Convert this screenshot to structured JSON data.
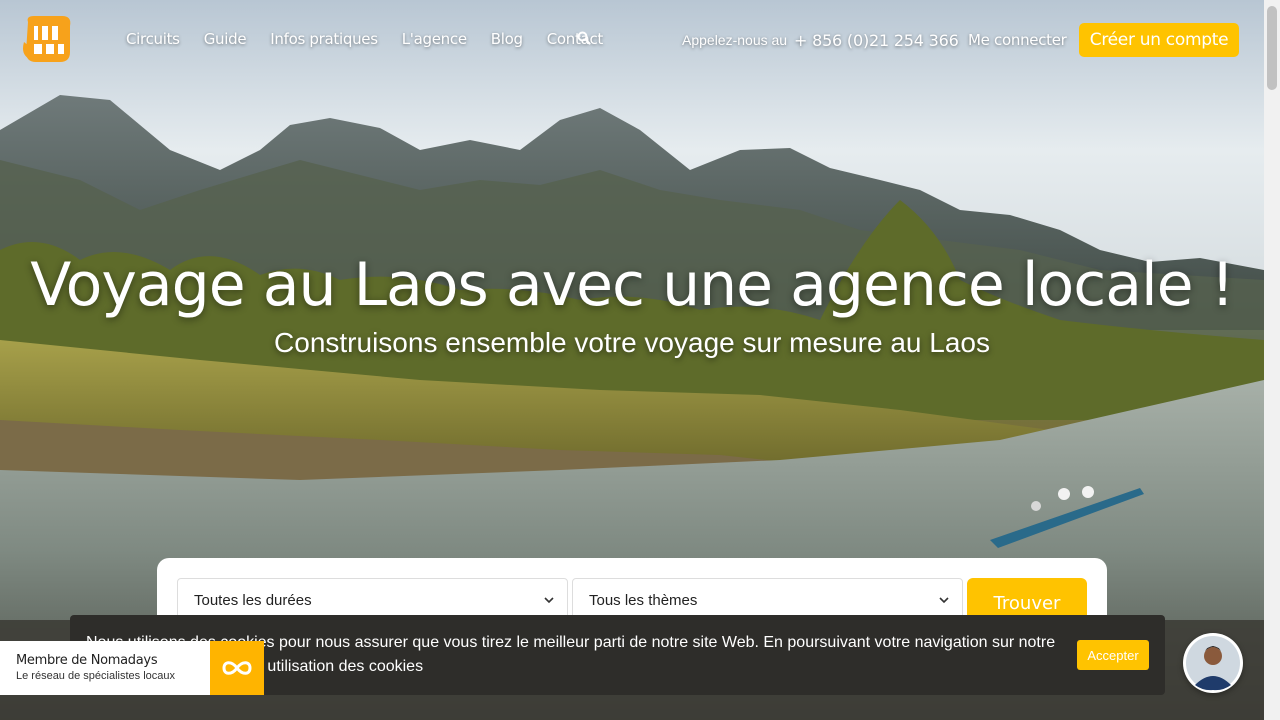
{
  "nav": {
    "links": [
      "Circuits",
      "Guide",
      "Infos pratiques",
      "L'agence",
      "Blog",
      "Contact"
    ],
    "call_label": "Appelez-nous au",
    "phone": "+ 856 (0)21 254 366",
    "login": "Me connecter",
    "create_account": "Créer un compte"
  },
  "hero": {
    "title": "Voyage au Laos avec une agence locale !",
    "subtitle": "Construisons ensemble votre voyage sur mesure au Laos"
  },
  "search": {
    "duration_selected": "Toutes les durées",
    "theme_selected": "Tous les thèmes",
    "find_label": "Trouver"
  },
  "cookie": {
    "text": "Nous utilisons des cookies pour nous assurer que vous tirez le meilleur parti de notre site Web. En poursuivant votre navigation sur notre site, vous acceptez notre utilisation des cookies",
    "accept_label": "Accepter"
  },
  "nomadays": {
    "title": "Membre de Nomadays",
    "subtitle": "Le réseau de spécialistes locaux"
  },
  "colors": {
    "accent": "#ffc300",
    "cookie_bg": "#2e2d2a"
  },
  "icons": {
    "search": "search-icon",
    "chevron": "chevron-down-icon",
    "nomadays": "infinity-icon",
    "chat": "chat-avatar"
  }
}
